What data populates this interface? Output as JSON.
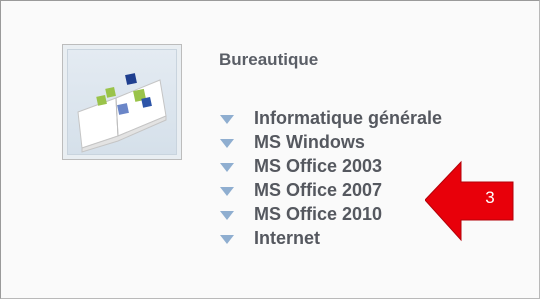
{
  "panel": {
    "icon": "open-book-icon",
    "title": "Bureautique",
    "items": [
      {
        "label": "Informatique générale",
        "icon": "triangle-down-icon"
      },
      {
        "label": "MS Windows",
        "icon": "triangle-down-icon"
      },
      {
        "label": "MS Office 2003",
        "icon": "triangle-down-icon"
      },
      {
        "label": "MS Office 2007",
        "icon": "triangle-down-icon"
      },
      {
        "label": "MS Office 2010",
        "icon": "triangle-down-icon"
      },
      {
        "label": "Internet",
        "icon": "triangle-down-icon"
      }
    ]
  },
  "callout": {
    "label": "3",
    "icon": "left-arrow-icon",
    "color": "#e8000a"
  },
  "colors": {
    "bullet": "#8faed0",
    "text": "#55585f"
  }
}
